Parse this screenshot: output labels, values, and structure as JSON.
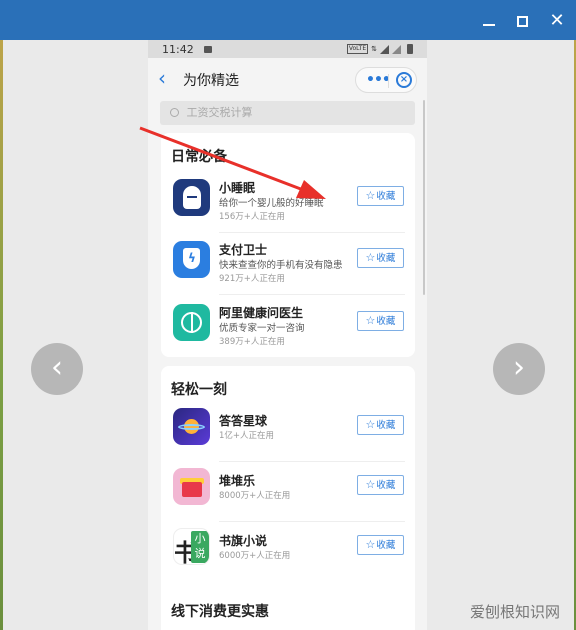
{
  "window": {
    "minimize_icon": "minimize-icon",
    "maximize_icon": "maximize-icon",
    "close_icon": "close-icon"
  },
  "viewer": {
    "prev_glyph": "‹",
    "next_glyph": "›"
  },
  "statusbar": {
    "time": "11:42",
    "volte": "VoLTE"
  },
  "appbar": {
    "back_glyph": "‹",
    "title": "为你精选",
    "more_glyph": "•••",
    "close_glyph": "×"
  },
  "search": {
    "placeholder": "工资交税计算"
  },
  "sections": [
    {
      "title": "日常必备",
      "apps": [
        {
          "name": "小睡眠",
          "desc": "给你一个婴儿般的好睡眠",
          "users": "156万+人正在用",
          "button": "收藏",
          "icon": "sleep-app-icon"
        },
        {
          "name": "支付卫士",
          "desc": "快来查查你的手机有没有隐患",
          "users": "921万+人正在用",
          "button": "收藏",
          "icon": "shield-app-icon"
        },
        {
          "name": "阿里健康问医生",
          "desc": "优质专家一对一咨询",
          "users": "389万+人正在用",
          "button": "收藏",
          "icon": "health-app-icon"
        }
      ]
    },
    {
      "title": "轻松一刻",
      "apps": [
        {
          "name": "答答星球",
          "users": "1亿+人正在用",
          "button": "收藏",
          "icon": "planet-app-icon"
        },
        {
          "name": "堆堆乐",
          "users": "8000万+人正在用",
          "button": "收藏",
          "icon": "stack-game-icon"
        },
        {
          "name": "书旗小说",
          "users": "6000万+人正在用",
          "button": "收藏",
          "icon": "book-app-icon"
        }
      ]
    },
    {
      "title": "线下消费更实惠",
      "apps": []
    }
  ],
  "book_icon_text": {
    "left": "书",
    "right": "小说",
    "small": "旗"
  },
  "watermark": {
    "text": "爱刨根知识网"
  },
  "colors": {
    "titlebar": "#2a70b8",
    "accent": "#2a7ad8",
    "arrow": "#e8302a"
  }
}
